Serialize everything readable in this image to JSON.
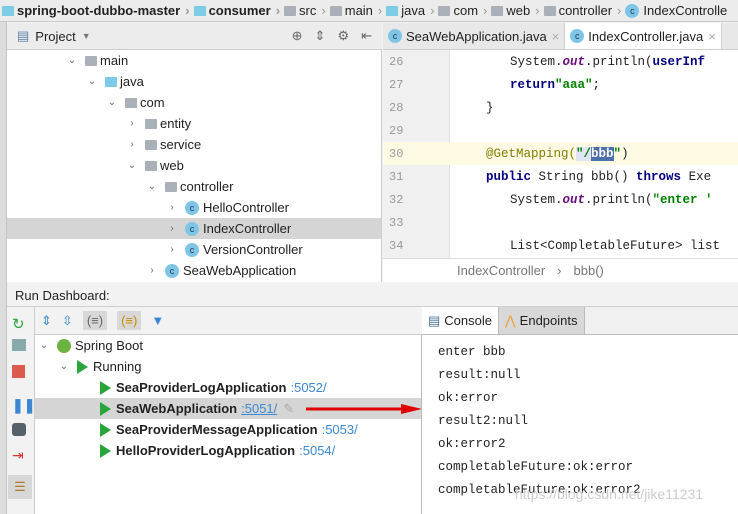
{
  "breadcrumb": [
    "spring-boot-dubbo-master",
    "consumer",
    "src",
    "main",
    "java",
    "com",
    "web",
    "controller",
    "IndexControlle"
  ],
  "project": {
    "title": "Project",
    "tree": [
      {
        "label": "main",
        "depth": 3,
        "open": true,
        "icon": "folder"
      },
      {
        "label": "java",
        "depth": 4,
        "open": true,
        "icon": "folder-blue"
      },
      {
        "label": "com",
        "depth": 5,
        "open": true,
        "icon": "package"
      },
      {
        "label": "entity",
        "depth": 6,
        "open": false,
        "icon": "package"
      },
      {
        "label": "service",
        "depth": 6,
        "open": false,
        "icon": "package"
      },
      {
        "label": "web",
        "depth": 6,
        "open": true,
        "icon": "package"
      },
      {
        "label": "controller",
        "depth": 7,
        "open": true,
        "icon": "package"
      },
      {
        "label": "HelloController",
        "depth": 8,
        "open": false,
        "icon": "class"
      },
      {
        "label": "IndexController",
        "depth": 8,
        "open": false,
        "icon": "class",
        "selected": true
      },
      {
        "label": "VersionController",
        "depth": 8,
        "open": false,
        "icon": "class"
      },
      {
        "label": "SeaWebApplication",
        "depth": 7,
        "open": false,
        "icon": "spring-class"
      }
    ]
  },
  "editor": {
    "tabs": [
      "SeaWebApplication.java",
      "IndexController.java"
    ],
    "active_tab": 1,
    "lines": [
      "26",
      "27",
      "28",
      "29",
      "30",
      "31",
      "32",
      "33",
      "34"
    ],
    "code": {
      "l26a": "System.",
      "l26b": "out",
      "l26c": ".println(",
      "l26d": "userInf",
      "l27a": "return",
      "l27b": "\"aaa\"",
      "l27c": ";",
      "l28": "}",
      "l30a": "@GetMapping(",
      "l30b": "\"/",
      "l30c": "bbb",
      "l30d": "\"",
      ")": ")",
      "l31a": "public",
      "l31b": " String bbb() ",
      "l31c": "throws",
      "l31d": " Exe",
      "l32a": "System.",
      "l32b": "out",
      "l32c": ".println(",
      "l32d": "\"enter '",
      "l34": "List<CompletableFuture> list"
    },
    "breadcrumb": [
      "IndexController",
      "bbb()"
    ]
  },
  "run": {
    "title": "Run Dashboard:",
    "group": "Spring Boot",
    "status": "Running",
    "apps": [
      {
        "name": "SeaProviderLogApplication",
        "port": ":5052/"
      },
      {
        "name": "SeaWebApplication",
        "port": ":5051/",
        "selected": true
      },
      {
        "name": "SeaProviderMessageApplication",
        "port": ":5053/"
      },
      {
        "name": "HelloProviderLogApplication",
        "port": ":5054/"
      }
    ]
  },
  "console": {
    "tabs": [
      "Console",
      "Endpoints"
    ],
    "lines": [
      "enter bbb",
      "result:null",
      "ok:error",
      "result2:null",
      "ok:error2",
      "completableFuture:ok:error",
      "completableFuture:ok:error2"
    ]
  },
  "watermark": "https://blog.csdn.net/jike11231",
  "colors": {
    "run_green": "#2aa43c",
    "link_blue": "#3b87d3",
    "arrow_red": "#e00000",
    "selection": "#4c6faa"
  }
}
